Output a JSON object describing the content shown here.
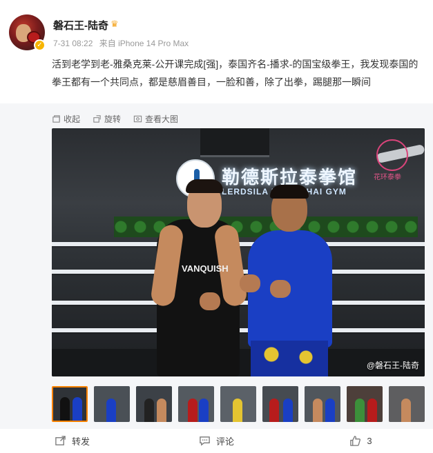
{
  "post": {
    "author": "磐石王-陆奇",
    "time": "7-31 08:22",
    "source": "来自 iPhone 14 Pro Max",
    "text": "活到老学到老-雅桑克莱-公开课完成[强]，泰国齐名-播求-的国宝级拳王，我发现泰国的拳王都有一个共同点，都是慈眉善目，一脸和善，除了出拳，踢腿那一瞬间"
  },
  "gallery": {
    "toolbar": {
      "collect": "收起",
      "rotate": "旋转",
      "view_large": "查看大图"
    },
    "photo": {
      "sign_cn": "勒德斯拉泰拳馆",
      "sign_en": "LERDSILA MUAY THAI GYM",
      "brand_text": "花环泰拳",
      "vest_text": "VANQUISH",
      "watermark": "@磐石王-陆奇"
    },
    "thumbnail_count": 9,
    "active_thumbnail": 1
  },
  "actions": {
    "repost": "转发",
    "comment": "评论",
    "like_count": "3"
  },
  "colors": {
    "accent": "#ff8200",
    "verify_badge": "#f7b500",
    "meta_text": "#999999",
    "gallery_bg": "#f5f6f8"
  }
}
